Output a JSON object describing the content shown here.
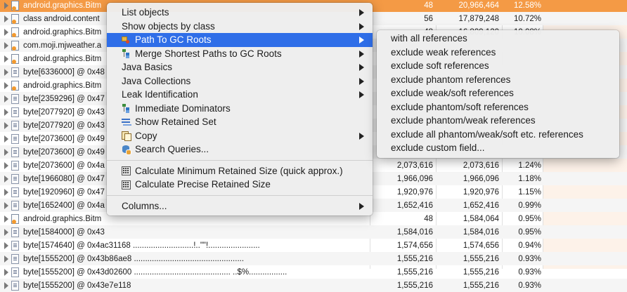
{
  "table": {
    "rows": [
      {
        "name": "android.graphics.Bitm",
        "shallow": "48",
        "retained": "20,966,464",
        "pct": "12.58%",
        "icon": "object",
        "selected": true
      },
      {
        "name": "class android.content",
        "shallow": "56",
        "retained": "17,879,248",
        "pct": "10.72%",
        "icon": "object"
      },
      {
        "name": "android.graphics.Bitm",
        "shallow": "48",
        "retained": "16,809,120",
        "pct": "10.08%",
        "icon": "object"
      },
      {
        "name": "com.moji.mjweather.a",
        "shallow": "",
        "retained": "",
        "pct": "",
        "icon": "object"
      },
      {
        "name": "android.graphics.Bitm",
        "shallow": "",
        "retained": "",
        "pct": "",
        "icon": "object"
      },
      {
        "name": "byte[6336000] @ 0x48",
        "shallow": "",
        "retained": "",
        "pct": "",
        "icon": "binary"
      },
      {
        "name": "android.graphics.Bitm",
        "shallow": "",
        "retained": "",
        "pct": "",
        "icon": "object"
      },
      {
        "name": "byte[2359296] @ 0x47",
        "shallow": "",
        "retained": "",
        "pct": "",
        "icon": "binary"
      },
      {
        "name": "byte[2077920] @ 0x43",
        "shallow": "",
        "retained": "",
        "pct": "",
        "icon": "binary"
      },
      {
        "name": "byte[2077920] @ 0x43",
        "shallow": "",
        "retained": "",
        "pct": "",
        "icon": "binary"
      },
      {
        "name": "byte[2073600] @ 0x49",
        "shallow": "",
        "retained": "",
        "pct": "",
        "icon": "binary"
      },
      {
        "name": "byte[2073600] @ 0x49",
        "shallow": "",
        "retained": "",
        "pct": "",
        "icon": "binary"
      },
      {
        "name": "byte[2073600] @ 0x4a",
        "shallow": "2,073,616",
        "retained": "2,073,616",
        "pct": "1.24%",
        "icon": "binary"
      },
      {
        "name": "byte[1966080] @ 0x47",
        "shallow": "1,966,096",
        "retained": "1,966,096",
        "pct": "1.18%",
        "icon": "binary"
      },
      {
        "name": "byte[1920960] @ 0x47",
        "shallow": "1,920,976",
        "retained": "1,920,976",
        "pct": "1.15%",
        "icon": "binary"
      },
      {
        "name": "byte[1652400] @ 0x4a",
        "shallow": "1,652,416",
        "retained": "1,652,416",
        "pct": "0.99%",
        "icon": "binary"
      },
      {
        "name": "android.graphics.Bitm",
        "shallow": "48",
        "retained": "1,584,064",
        "pct": "0.95%",
        "icon": "object"
      },
      {
        "name": "byte[1584000] @ 0x43",
        "shallow": "1,584,016",
        "retained": "1,584,016",
        "pct": "0.95%",
        "icon": "binary"
      },
      {
        "name": "byte[1574640] @ 0x4ac31168  ...........................!..\"\"!.......................",
        "shallow": "1,574,656",
        "retained": "1,574,656",
        "pct": "0.94%",
        "icon": "binary"
      },
      {
        "name": "byte[1555200] @ 0x43b86ae8  .................................................",
        "shallow": "1,555,216",
        "retained": "1,555,216",
        "pct": "0.93%",
        "icon": "binary"
      },
      {
        "name": "byte[1555200] @ 0x43d02600  ........................................... ..$%.................",
        "shallow": "1,555,216",
        "retained": "1,555,216",
        "pct": "0.93%",
        "icon": "binary"
      },
      {
        "name": "byte[1555200] @ 0x43e7e118",
        "shallow": "1,555,216",
        "retained": "1,555,216",
        "pct": "0.93%",
        "icon": "binary"
      }
    ]
  },
  "context_menu": {
    "items": [
      {
        "label": "List objects",
        "submenu": true
      },
      {
        "label": "Show objects by class",
        "submenu": true
      },
      {
        "label": "Path To GC Roots",
        "submenu": true,
        "icon": "gc-roots-icon",
        "highlighted": true
      },
      {
        "label": "Merge Shortest Paths to GC Roots",
        "submenu": true,
        "icon": "merge-paths-icon"
      },
      {
        "label": "Java Basics",
        "submenu": true
      },
      {
        "label": "Java Collections",
        "submenu": true
      },
      {
        "label": "Leak Identification",
        "submenu": true
      },
      {
        "label": "Immediate Dominators",
        "icon": "dominators-icon"
      },
      {
        "label": "Show Retained Set",
        "icon": "retained-set-icon"
      },
      {
        "label": "Copy",
        "submenu": true,
        "icon": "copy-icon"
      },
      {
        "label": "Search Queries...",
        "icon": "search-queries-icon"
      },
      {
        "separator": true
      },
      {
        "label": "Calculate Minimum Retained Size (quick approx.)",
        "icon": "calculator-icon"
      },
      {
        "label": "Calculate Precise Retained Size",
        "icon": "calculator-icon"
      },
      {
        "separator": true
      },
      {
        "label": "Columns...",
        "submenu": true
      }
    ]
  },
  "submenu": {
    "items": [
      "with all references",
      "exclude weak references",
      "exclude soft references",
      "exclude phantom references",
      "exclude weak/soft references",
      "exclude phantom/soft references",
      "exclude phantom/weak references",
      "exclude all phantom/weak/soft etc. references",
      "exclude custom field..."
    ]
  },
  "colors": {
    "selection": "#f49a45",
    "menu_highlight": "#2f6ee8",
    "percent_column_bg": "#fdf2e9"
  }
}
